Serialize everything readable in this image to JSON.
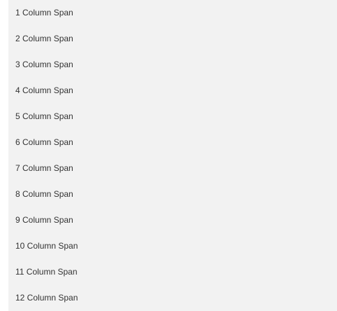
{
  "column_spans": {
    "items": [
      {
        "label": "1 Column Span"
      },
      {
        "label": "2 Column Span"
      },
      {
        "label": "3 Column Span"
      },
      {
        "label": "4 Column Span"
      },
      {
        "label": "5 Column Span"
      },
      {
        "label": "6 Column Span"
      },
      {
        "label": "7 Column Span"
      },
      {
        "label": "8 Column Span"
      },
      {
        "label": "9 Column Span"
      },
      {
        "label": "10 Column Span"
      },
      {
        "label": "11 Column Span"
      },
      {
        "label": "12 Column Span"
      }
    ]
  },
  "colors": {
    "panel_background": "#f2f2f2",
    "text": "#333333"
  }
}
